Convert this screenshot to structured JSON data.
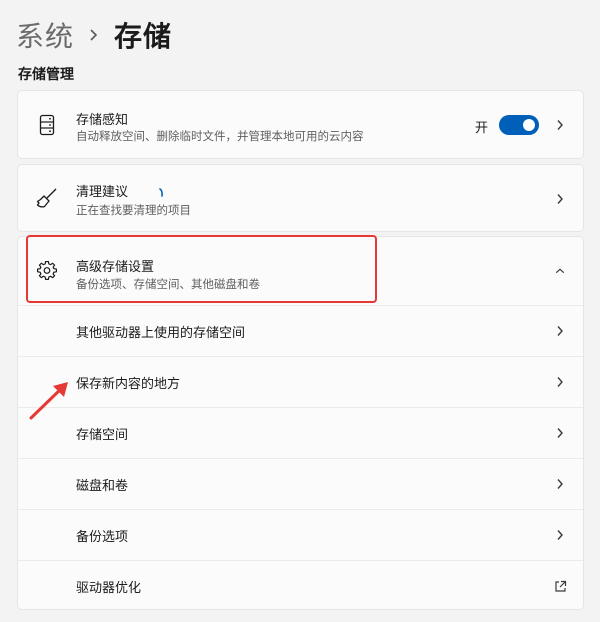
{
  "breadcrumb": {
    "parent": "系统",
    "separator_icon": "chevron-right-icon",
    "current": "存储"
  },
  "section": {
    "title": "存储管理"
  },
  "storage_sense": {
    "icon": "storage-drive-icon",
    "title": "存储感知",
    "subtitle": "自动释放空间、删除临时文件，并管理本地可用的云内容",
    "toggle_label": "开",
    "toggle_on": true
  },
  "cleanup": {
    "icon": "broom-icon",
    "title": "清理建议",
    "subtitle": "正在查找要清理的项目"
  },
  "advanced": {
    "icon": "gear-icon",
    "title": "高级存储设置",
    "subtitle": "备份选项、存储空间、其他磁盘和卷",
    "expanded": true,
    "items": [
      {
        "label": "其他驱动器上使用的存储空间",
        "icon": "chevron-right-icon"
      },
      {
        "label": "保存新内容的地方",
        "icon": "chevron-right-icon"
      },
      {
        "label": "存储空间",
        "icon": "chevron-right-icon"
      },
      {
        "label": "磁盘和卷",
        "icon": "chevron-right-icon"
      },
      {
        "label": "备份选项",
        "icon": "chevron-right-icon"
      },
      {
        "label": "驱动器优化",
        "icon": "external-link-icon"
      }
    ]
  },
  "colors": {
    "accent": "#005fb8",
    "annotation": "#e53935",
    "background": "#f3f3f3",
    "card": "#fbfbfb"
  }
}
